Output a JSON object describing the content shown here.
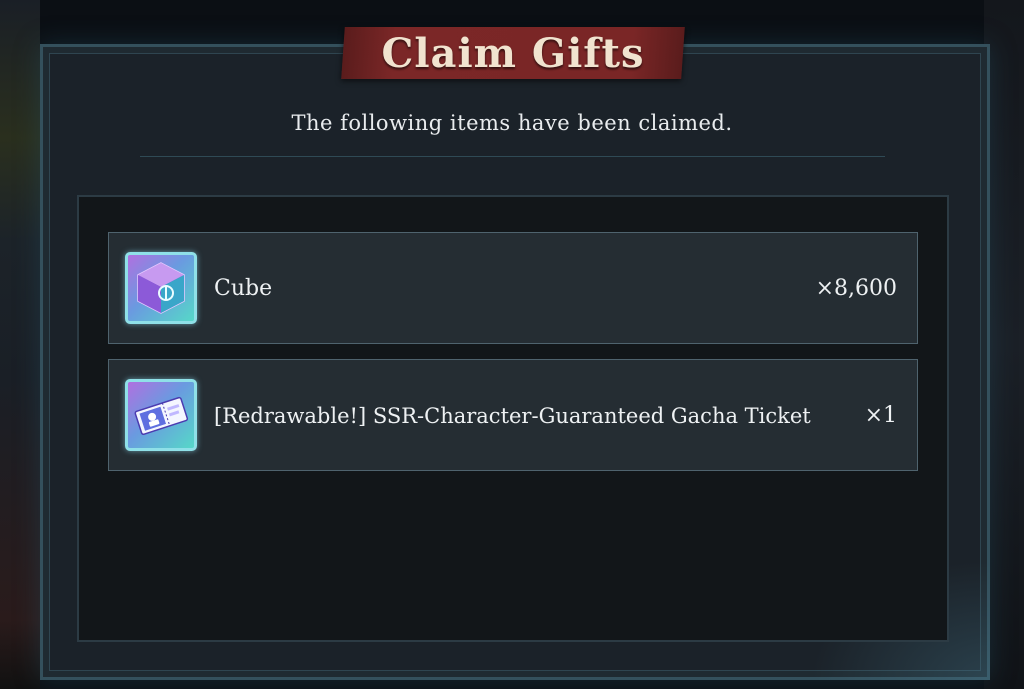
{
  "dialog": {
    "title": "Claim Gifts",
    "subtitle": "The following items have been claimed."
  },
  "items": [
    {
      "name": "Cube",
      "quantity": "×8,600",
      "icon": "cube-icon"
    },
    {
      "name": "[Redrawable!] SSR-Character-Guaranteed Gacha Ticket",
      "quantity": "×1",
      "icon": "gacha-ticket-icon"
    }
  ],
  "colors": {
    "title_banner": "#7b2727",
    "frame_border": "#34505c",
    "panel_bg": "#1b2229",
    "item_bg": "#252d33",
    "icon_border": "#8fe0e8"
  }
}
